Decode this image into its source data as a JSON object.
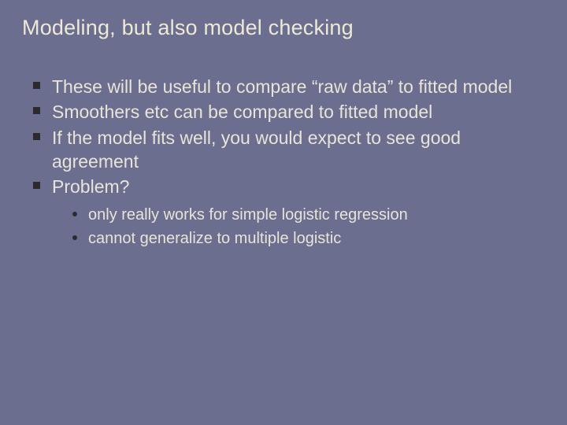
{
  "slide": {
    "title": "Modeling, but also model checking",
    "bullets": [
      {
        "text": "These will be useful to compare “raw data” to fitted model"
      },
      {
        "text": "Smoothers etc can be compared to fitted model"
      },
      {
        "text": "If the model fits well, you would expect to see good agreement"
      },
      {
        "text": "Problem?"
      }
    ],
    "subbullets": [
      {
        "text": "only really works for simple logistic regression"
      },
      {
        "text": "cannot generalize to multiple logistic"
      }
    ]
  }
}
